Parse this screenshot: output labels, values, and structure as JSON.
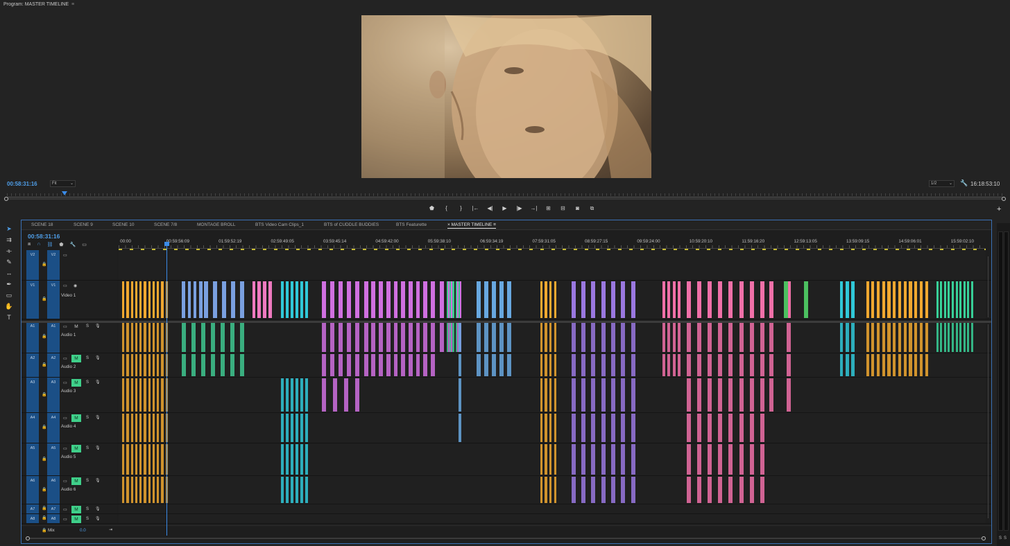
{
  "program": {
    "title": "Program: MASTER TIMELINE",
    "menu_icon": "hamburger-icon",
    "timecode": "00:58:31:16",
    "fit": "Fit",
    "resolution": "1/2",
    "duration": "16:18:53:10",
    "playhead_fraction": 0.06
  },
  "transport": [
    {
      "icon": "marker-icon",
      "glyph": "⬟"
    },
    {
      "icon": "mark-in-icon",
      "glyph": "{"
    },
    {
      "icon": "mark-out-icon",
      "glyph": "}"
    },
    {
      "icon": "go-to-in-icon",
      "glyph": "|←"
    },
    {
      "icon": "step-back-icon",
      "glyph": "◀|"
    },
    {
      "icon": "play-icon",
      "glyph": "▶"
    },
    {
      "icon": "step-forward-icon",
      "glyph": "|▶"
    },
    {
      "icon": "go-to-out-icon",
      "glyph": "→|"
    },
    {
      "icon": "lift-icon",
      "glyph": "⊞"
    },
    {
      "icon": "extract-icon",
      "glyph": "⊟"
    },
    {
      "icon": "export-frame-icon",
      "glyph": "◙"
    },
    {
      "icon": "compare-icon",
      "glyph": "⧉"
    }
  ],
  "tools": [
    {
      "name": "selection-tool-icon",
      "glyph": "➤",
      "active": true
    },
    {
      "name": "track-select-icon",
      "glyph": "⇉"
    },
    {
      "name": "ripple-edit-icon",
      "glyph": "⟛"
    },
    {
      "name": "razor-icon",
      "glyph": "✎"
    },
    {
      "name": "slip-icon",
      "glyph": "↔"
    },
    {
      "name": "pen-icon",
      "glyph": "✒"
    },
    {
      "name": "rectangle-icon",
      "glyph": "▭"
    },
    {
      "name": "hand-icon",
      "glyph": "✋"
    },
    {
      "name": "type-icon",
      "glyph": "T"
    }
  ],
  "tabs": [
    "SCENE 18",
    "SCENE 9",
    "SCENE 10",
    "SCENE 7/8",
    "MONTAGE BROLL",
    "BTS Video Cam Clips_1",
    "BTS of CUDDLE BUDDIES",
    "BTS Featurette",
    "MASTER TIMELINE"
  ],
  "active_tab": "MASTER TIMELINE",
  "timeline": {
    "timecode": "00:58:31:16",
    "ruler": [
      "00:00",
      "00:59:56:09",
      "01:59:52:19",
      "02:59:49:05",
      "03:59:45:14",
      "04:59:42:00",
      "05:59:38:10",
      "06:59:34:19",
      "07:59:31:05",
      "08:59:27:15",
      "09:59:24:00",
      "10:59:20:10",
      "11:59:16:20",
      "12:59:13:05",
      "13:59:09:15",
      "14:59:06:01",
      "15:59:02:10"
    ],
    "mix_label": "Mix",
    "mix_value": "0.0"
  },
  "tracks": [
    {
      "id": "V2",
      "src": "V2",
      "name": "",
      "type": "video",
      "height": 44
    },
    {
      "id": "V1",
      "src": "V1",
      "name": "Video 1",
      "type": "video",
      "height": 56
    },
    {
      "id": "A1",
      "src": "A1",
      "name": "Audio 1",
      "type": "audio",
      "height": 46,
      "m": false
    },
    {
      "id": "A2",
      "src": "A2",
      "name": "Audio 2",
      "type": "audio",
      "height": 35,
      "m": true
    },
    {
      "id": "A3",
      "src": "A3",
      "name": "Audio 3",
      "type": "audio",
      "height": 51,
      "m": true
    },
    {
      "id": "A4",
      "src": "A4",
      "name": "Audio 4",
      "type": "audio",
      "height": 44,
      "m": true
    },
    {
      "id": "A5",
      "src": "A5",
      "name": "Audio 5",
      "type": "audio",
      "height": 47,
      "m": true
    },
    {
      "id": "A6",
      "src": "A6",
      "name": "Audio 6",
      "type": "audio",
      "height": 41,
      "m": true
    },
    {
      "id": "A7",
      "src": "A7",
      "name": "",
      "type": "audio",
      "height": 14,
      "m": true
    },
    {
      "id": "A8",
      "src": "A8",
      "name": "",
      "type": "audio",
      "height": 14,
      "m": true
    }
  ],
  "colors": {
    "orange": "#f0a830",
    "blue": "#7aa0e0",
    "pink": "#f07ac0",
    "teal": "#30c8d8",
    "violet": "#d070e0",
    "green": "#40c890",
    "sky": "#68a8e0",
    "purple": "#9a78e0",
    "rose": "#f070a8",
    "lime": "#4cc060",
    "yellow": "#f0a830",
    "mint": "#38d098",
    "playhead": "#3a8be8",
    "m_button": "#3fd08a"
  },
  "clip_groups": [
    {
      "color": "orange",
      "from": 0.004,
      "to": 0.054,
      "count": 11,
      "rows": [
        "V1",
        "A1",
        "A2",
        "A3",
        "A4",
        "A5",
        "A6"
      ]
    },
    {
      "color": "blue",
      "from": 0.073,
      "to": 0.093,
      "count": 4,
      "rows": [
        "V1"
      ]
    },
    {
      "color": "green",
      "from": 0.073,
      "to": 0.14,
      "count": 7,
      "rows": [
        "A1",
        "A2"
      ]
    },
    {
      "color": "blue",
      "from": 0.098,
      "to": 0.14,
      "count": 5,
      "rows": [
        "V1"
      ]
    },
    {
      "color": "pink",
      "from": 0.154,
      "to": 0.173,
      "count": 4,
      "rows": [
        "V1"
      ]
    },
    {
      "color": "teal",
      "from": 0.187,
      "to": 0.215,
      "count": 6,
      "rows": [
        "V1",
        "A3",
        "A4",
        "A5",
        "A6"
      ]
    },
    {
      "color": "violet",
      "from": 0.234,
      "to": 0.273,
      "count": 5,
      "rows": [
        "V1",
        "A1",
        "A2"
      ]
    },
    {
      "color": "violet",
      "from": 0.234,
      "to": 0.273,
      "count": 4,
      "rows": [
        "A3"
      ]
    },
    {
      "color": "violet",
      "from": 0.283,
      "to": 0.36,
      "count": 10,
      "rows": [
        "V1",
        "A1",
        "A2"
      ]
    },
    {
      "color": "violet",
      "from": 0.37,
      "to": 0.39,
      "count": 3,
      "rows": [
        "V1",
        "A1"
      ]
    },
    {
      "color": "green",
      "from": 0.378,
      "to": 0.392,
      "count": 5,
      "rows": [
        "V1",
        "A1"
      ]
    },
    {
      "color": "sky",
      "from": 0.392,
      "to": 0.403,
      "count": 1,
      "rows": [
        "A1",
        "A2",
        "A3",
        "A4"
      ]
    },
    {
      "color": "sky",
      "from": 0.413,
      "to": 0.448,
      "count": 5,
      "rows": [
        "V1",
        "A1",
        "A2"
      ]
    },
    {
      "color": "orange",
      "from": 0.486,
      "to": 0.502,
      "count": 4,
      "rows": [
        "V1",
        "A1",
        "A2",
        "A3",
        "A4",
        "A5",
        "A6"
      ]
    },
    {
      "color": "purple",
      "from": 0.522,
      "to": 0.591,
      "count": 7,
      "rows": [
        "V1",
        "A1",
        "A2",
        "A3",
        "A4",
        "A5",
        "A6"
      ]
    },
    {
      "color": "rose",
      "from": 0.627,
      "to": 0.645,
      "count": 4,
      "rows": [
        "V1",
        "A1",
        "A2"
      ]
    },
    {
      "color": "rose",
      "from": 0.655,
      "to": 0.74,
      "count": 8,
      "rows": [
        "V1",
        "A1",
        "A2",
        "A3",
        "A4",
        "A5",
        "A6"
      ]
    },
    {
      "color": "rose",
      "from": 0.75,
      "to": 0.77,
      "count": 2,
      "rows": [
        "V1",
        "A1",
        "A2",
        "A3"
      ]
    },
    {
      "color": "lime",
      "from": 0.767,
      "to": 0.79,
      "count": 2,
      "rows": [
        "V1"
      ]
    },
    {
      "color": "teal",
      "from": 0.832,
      "to": 0.845,
      "count": 3,
      "rows": [
        "V1",
        "A1",
        "A2"
      ]
    },
    {
      "color": "orange",
      "from": 0.862,
      "to": 0.93,
      "count": 12,
      "rows": [
        "V1",
        "A1",
        "A2"
      ]
    },
    {
      "color": "mint",
      "from": 0.943,
      "to": 0.983,
      "count": 10,
      "rows": [
        "V1",
        "A1"
      ]
    }
  ]
}
